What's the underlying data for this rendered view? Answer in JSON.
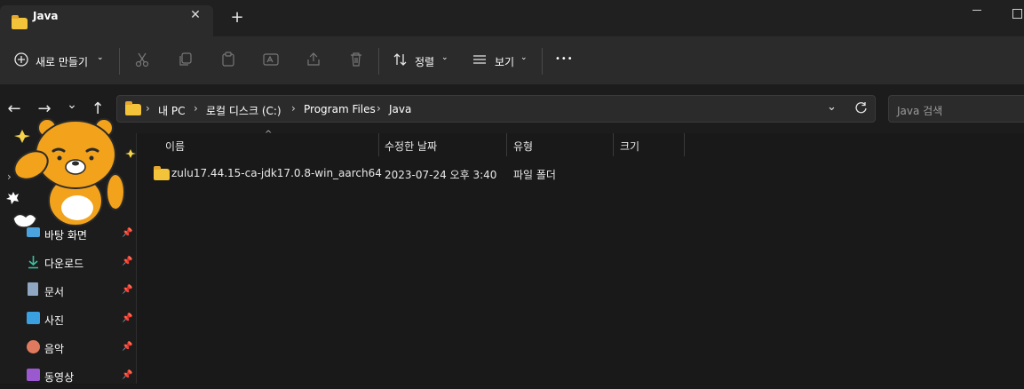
{
  "window": {
    "tab_title": "Java",
    "close_glyph": "✕",
    "new_tab_glyph": "+"
  },
  "toolbar": {
    "new_label": "새로 만들기",
    "sort_label": "정렬",
    "view_label": "보기",
    "more_glyph": "•••"
  },
  "address": {
    "crumbs": [
      "내 PC",
      "로컬 디스크 (C:)",
      "Program Files",
      "Java"
    ],
    "search_placeholder": "Java 검색"
  },
  "sidebar": {
    "items": [
      {
        "label": "바탕 화면",
        "icon": "desktop-icon"
      },
      {
        "label": "다운로드",
        "icon": "download-icon"
      },
      {
        "label": "문서",
        "icon": "document-icon"
      },
      {
        "label": "사진",
        "icon": "pictures-icon"
      },
      {
        "label": "음악",
        "icon": "music-icon"
      },
      {
        "label": "동영상",
        "icon": "video-icon"
      }
    ]
  },
  "columns": [
    "이름",
    "수정한 날짜",
    "유형",
    "크기"
  ],
  "files": [
    {
      "name": "zulu17.44.15-ca-jdk17.0.8-win_aarch64",
      "modified": "2023-07-24 오후 3:40",
      "type": "파일 폴더",
      "size": ""
    }
  ],
  "colors": {
    "folder": "#f3c33a",
    "accent": "#4cc2ff",
    "background": "#191919"
  }
}
